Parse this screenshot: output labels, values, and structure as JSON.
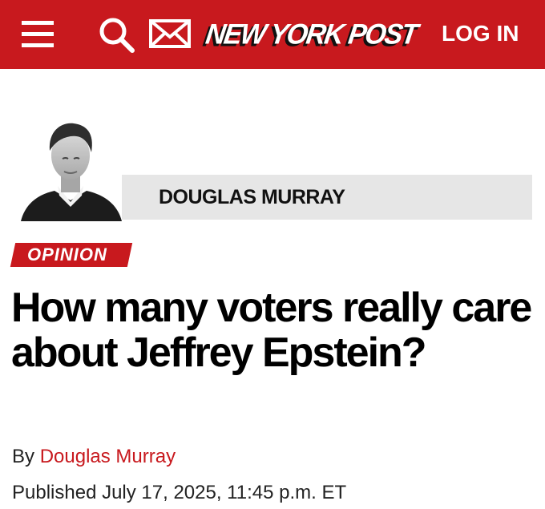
{
  "header": {
    "menu_icon": "hamburger-menu-icon",
    "search_icon": "search-icon",
    "mail_icon": "mail-icon",
    "logo_text": "NEW YORK POST",
    "login_label": "LOG IN",
    "brand_color": "#c8191e"
  },
  "author": {
    "name": "DOUGLAS MURRAY"
  },
  "article": {
    "category": "OPINION",
    "headline": "How many voters really care about Jeffrey Epstein?",
    "byline_prefix": "By",
    "byline_author": "Douglas Murray",
    "published": "Published July 17, 2025, 11:45 p.m. ET"
  }
}
